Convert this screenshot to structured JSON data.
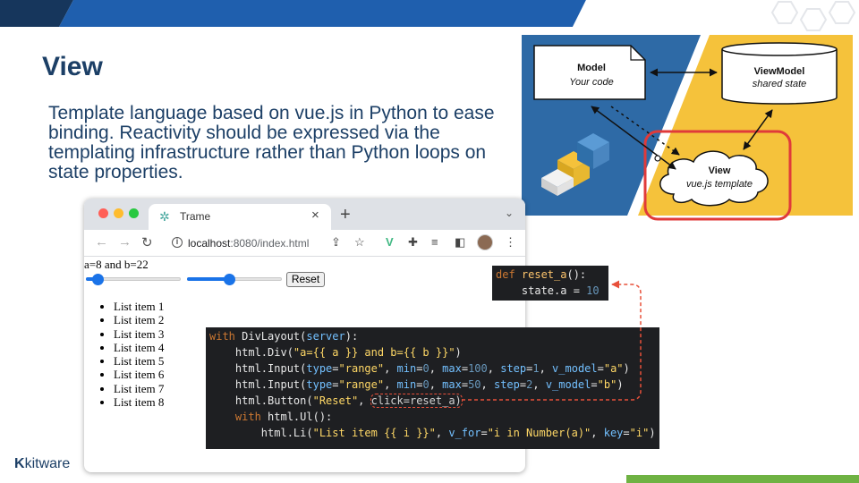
{
  "slide": {
    "title": "View",
    "body": "Template language based on vue.js in Python to ease binding. Reactivity should be expressed via the templating infrastructure rather than Python loops on state properties."
  },
  "diagram": {
    "model": {
      "title": "Model",
      "subtitle": "Your code"
    },
    "viewmodel": {
      "title": "ViewModel",
      "subtitle": "shared state"
    },
    "view": {
      "title": "View",
      "subtitle": "vue.js template"
    },
    "colors": {
      "left_panel": "#2e6aa6",
      "right_panel": "#f5c23b",
      "highlight": "#e03a3a"
    }
  },
  "browser": {
    "tab_title": "Trame",
    "tab_close": "×",
    "new_tab": "+",
    "tab_menu": "⌄",
    "url_host": "localhost",
    "url_rest": ":8080/index.html",
    "icons": [
      "back-arrow",
      "forward-arrow",
      "reload",
      "info",
      "share",
      "star",
      "vue-extension",
      "puzzle-extension",
      "reading-list",
      "sidebar",
      "profile-avatar",
      "menu-kebab"
    ]
  },
  "page": {
    "ab_text": "a=8 and b=22",
    "slider_a": {
      "value": 8,
      "max": 100
    },
    "slider_b": {
      "value": 22,
      "max": 50
    },
    "reset_label": "Reset",
    "items": [
      "List item 1",
      "List item 2",
      "List item 3",
      "List item 4",
      "List item 5",
      "List item 6",
      "List item 7",
      "List item 8"
    ]
  },
  "code_small": [
    {
      "parts": [
        {
          "t": "def ",
          "c": "kw"
        },
        {
          "t": "reset_a",
          "c": "fn"
        },
        {
          "t": "():",
          "c": "id"
        }
      ]
    },
    {
      "parts": [
        {
          "t": "    state.a = ",
          "c": "id"
        },
        {
          "t": "10",
          "c": "num"
        }
      ]
    }
  ],
  "code_big": [
    {
      "parts": [
        {
          "t": "with ",
          "c": "kw"
        },
        {
          "t": "DivLayout(",
          "c": "id"
        },
        {
          "t": "server",
          "c": "attr"
        },
        {
          "t": "):",
          "c": "id"
        }
      ]
    },
    {
      "parts": [
        {
          "t": "    html.Div(",
          "c": "id"
        },
        {
          "t": "\"a={{ a }} and b={{ b }}\"",
          "c": "str"
        },
        {
          "t": ")",
          "c": "id"
        }
      ]
    },
    {
      "parts": [
        {
          "t": "    html.Input(",
          "c": "id"
        },
        {
          "t": "type",
          "c": "attr"
        },
        {
          "t": "=",
          "c": "id"
        },
        {
          "t": "\"range\"",
          "c": "str"
        },
        {
          "t": ", ",
          "c": "id"
        },
        {
          "t": "min",
          "c": "attr"
        },
        {
          "t": "=",
          "c": "id"
        },
        {
          "t": "0",
          "c": "num"
        },
        {
          "t": ", ",
          "c": "id"
        },
        {
          "t": "max",
          "c": "attr"
        },
        {
          "t": "=",
          "c": "id"
        },
        {
          "t": "100",
          "c": "num"
        },
        {
          "t": ", ",
          "c": "id"
        },
        {
          "t": "step",
          "c": "attr"
        },
        {
          "t": "=",
          "c": "id"
        },
        {
          "t": "1",
          "c": "num"
        },
        {
          "t": ", ",
          "c": "id"
        },
        {
          "t": "v_model",
          "c": "attr"
        },
        {
          "t": "=",
          "c": "id"
        },
        {
          "t": "\"a\"",
          "c": "str"
        },
        {
          "t": ")",
          "c": "id"
        }
      ]
    },
    {
      "parts": [
        {
          "t": "    html.Input(",
          "c": "id"
        },
        {
          "t": "type",
          "c": "attr"
        },
        {
          "t": "=",
          "c": "id"
        },
        {
          "t": "\"range\"",
          "c": "str"
        },
        {
          "t": ", ",
          "c": "id"
        },
        {
          "t": "min",
          "c": "attr"
        },
        {
          "t": "=",
          "c": "id"
        },
        {
          "t": "0",
          "c": "num"
        },
        {
          "t": ", ",
          "c": "id"
        },
        {
          "t": "max",
          "c": "attr"
        },
        {
          "t": "=",
          "c": "id"
        },
        {
          "t": "50",
          "c": "num"
        },
        {
          "t": ", ",
          "c": "id"
        },
        {
          "t": "step",
          "c": "attr"
        },
        {
          "t": "=",
          "c": "id"
        },
        {
          "t": "2",
          "c": "num"
        },
        {
          "t": ", ",
          "c": "id"
        },
        {
          "t": "v_model",
          "c": "attr"
        },
        {
          "t": "=",
          "c": "id"
        },
        {
          "t": "\"b\"",
          "c": "str"
        },
        {
          "t": ")",
          "c": "id"
        }
      ]
    },
    {
      "parts": [
        {
          "t": "    html.Button(",
          "c": "id"
        },
        {
          "t": "\"Reset\"",
          "c": "str"
        },
        {
          "t": ", ",
          "c": "id"
        },
        {
          "t": "click=reset_a)",
          "c": "hl"
        }
      ]
    },
    {
      "parts": [
        {
          "t": "    with ",
          "c": "kw"
        },
        {
          "t": "html.Ul():",
          "c": "id"
        }
      ]
    },
    {
      "parts": [
        {
          "t": "        html.Li(",
          "c": "id"
        },
        {
          "t": "\"List item {{ i }}\"",
          "c": "str"
        },
        {
          "t": ", ",
          "c": "id"
        },
        {
          "t": "v_for",
          "c": "attr"
        },
        {
          "t": "=",
          "c": "id"
        },
        {
          "t": "\"i in Number(a)\"",
          "c": "str"
        },
        {
          "t": ", ",
          "c": "id"
        },
        {
          "t": "key",
          "c": "attr"
        },
        {
          "t": "=",
          "c": "id"
        },
        {
          "t": "\"i\"",
          "c": "str"
        },
        {
          "t": ")",
          "c": "id"
        }
      ]
    }
  ],
  "footer": {
    "logo_mark": "K",
    "logo_text": "kitware",
    "accent": "#6fb243"
  }
}
